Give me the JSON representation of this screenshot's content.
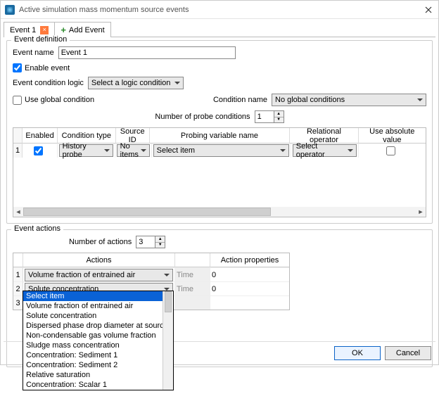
{
  "title": "Active simulation mass momentum source events",
  "tabs": {
    "event1": "Event 1",
    "add": "Add Event"
  },
  "def": {
    "group": "Event definition",
    "name_lbl": "Event name",
    "name_val": "Event 1",
    "enable": "Enable event",
    "logic_lbl": "Event condition logic",
    "logic_val": "Select a logic condition",
    "global": "Use global condition",
    "cond_name_lbl": "Condition name",
    "cond_name_val": "No global conditions",
    "probe_lbl": "Number of probe conditions",
    "probe_val": "1",
    "cols": {
      "en": "Enabled",
      "ct": "Condition type",
      "sid": "Source ID",
      "pv": "Probing variable name",
      "ro": "Relational operator",
      "av": "Use absolute value"
    },
    "row": {
      "n": "1",
      "ct": "History probe",
      "sid": "No items",
      "pv": "Select item",
      "ro": "Select operator"
    }
  },
  "act": {
    "group": "Event actions",
    "num_lbl": "Number of actions",
    "num_val": "3",
    "cols": {
      "a": "Actions",
      "pl": "",
      "pv": "Action properties"
    },
    "rows": [
      {
        "n": "1",
        "a": "Volume fraction of entrained air",
        "pl": "Time",
        "pv": "0"
      },
      {
        "n": "2",
        "a": "Solute concentration",
        "pl": "Time",
        "pv": "0"
      },
      {
        "n": "3",
        "a": "Select item",
        "pl": "",
        "pv": ""
      }
    ]
  },
  "dropdown": [
    "Select item",
    "Volume fraction of entrained air",
    "Solute concentration",
    "Dispersed phase drop diameter at source",
    "Non-condensable gas volume fraction",
    "Sludge mass concentration",
    "Concentration: Sediment 1",
    "Concentration: Sediment 2",
    "Relative saturation",
    "Concentration: Scalar 1"
  ],
  "buttons": {
    "ok": "OK",
    "cancel": "Cancel"
  }
}
